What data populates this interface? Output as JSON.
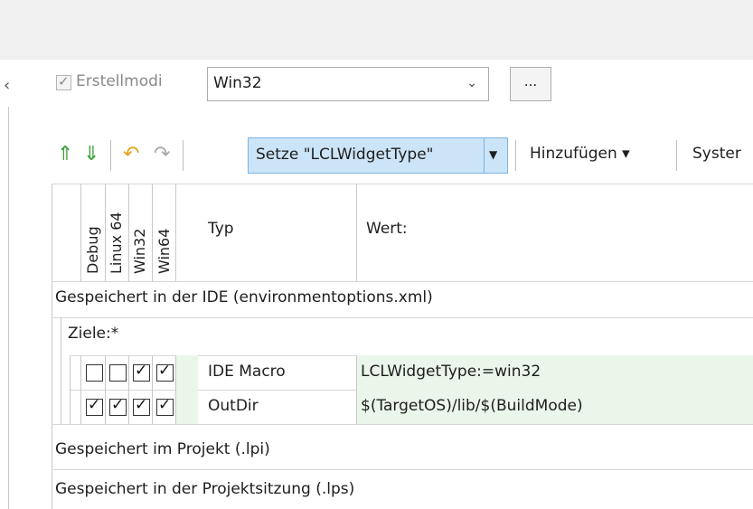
{
  "toolbar_top": {
    "build_modes_label": "Erstellmodi",
    "build_mode_value": "Win32",
    "more_button": "..."
  },
  "toolbar": {
    "setze_label": "Setze \"LCLWidgetType\"",
    "hinzufuegen_label": "Hinzufügen ▾",
    "system_label": "Syster"
  },
  "table": {
    "columns": [
      "Debug",
      "Linux 64",
      "Win32",
      "Win64"
    ],
    "col_typ": "Typ",
    "col_wert": "Wert:",
    "group_ide": "Gespeichert in der IDE (environmentoptions.xml)",
    "subgroup_ziele": "Ziele:*",
    "rows": [
      {
        "checks": [
          false,
          false,
          true,
          true
        ],
        "typ": "IDE Macro",
        "wert": "LCLWidgetType:=win32"
      },
      {
        "checks": [
          true,
          true,
          true,
          true
        ],
        "typ": "OutDir",
        "wert": "$(TargetOS)/lib/$(BuildMode)"
      }
    ],
    "group_project": "Gespeichert im Projekt (.lpi)",
    "group_session": "Gespeichert in der Projektsitzung (.lps)"
  }
}
